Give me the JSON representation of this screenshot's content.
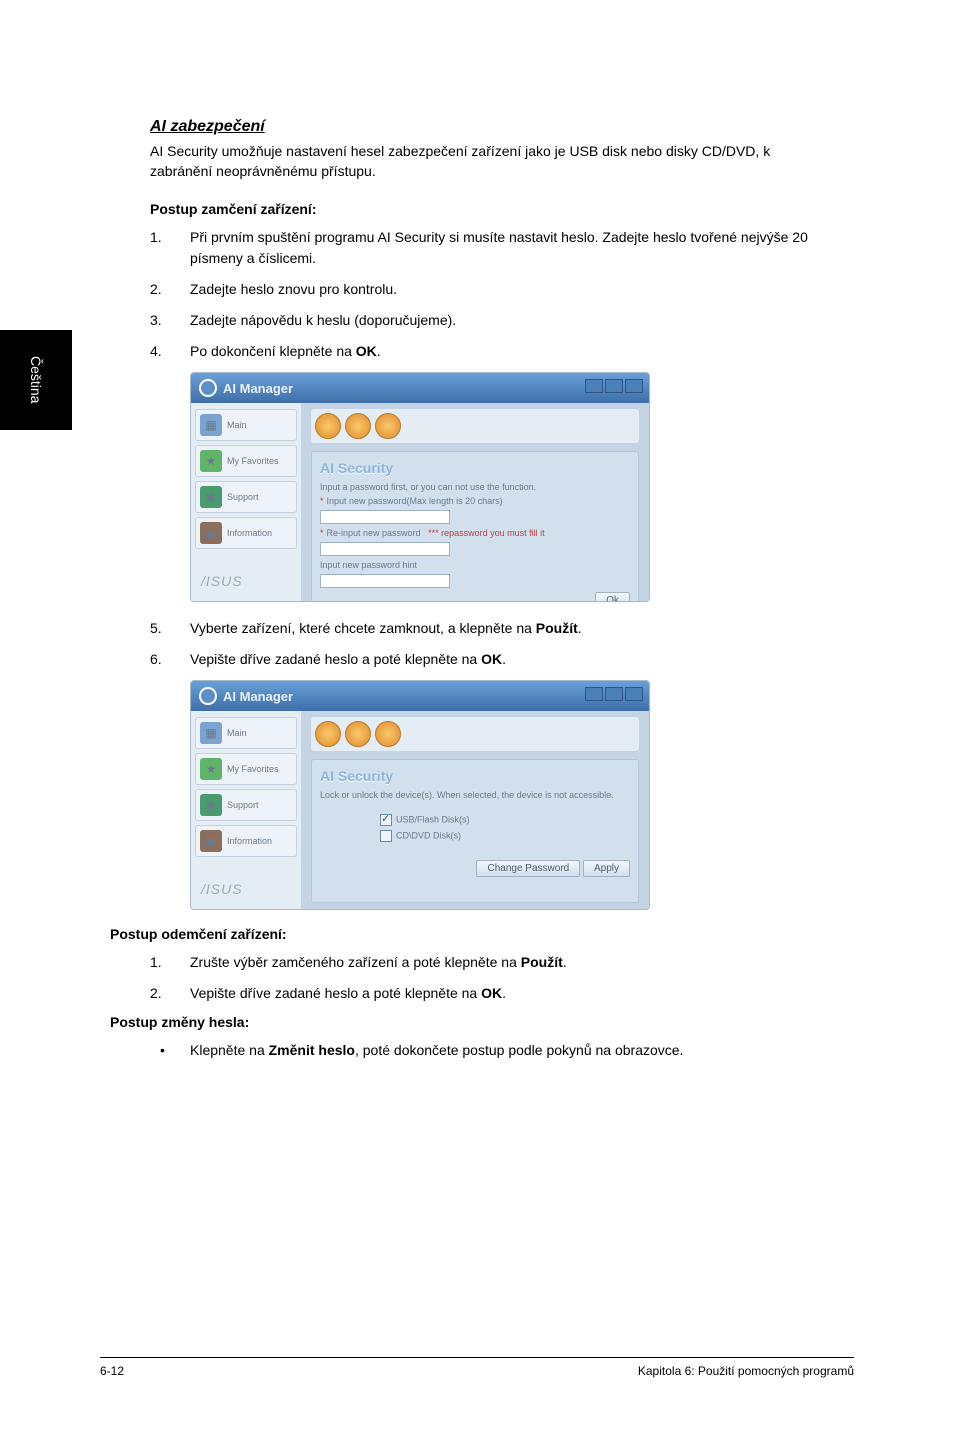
{
  "sideTab": "Čeština",
  "sectionTitle": "AI zabezpečení",
  "intro": "AI Security umožňuje nastavení hesel zabezpečení zařízení jako je USB disk nebo disky CD/DVD, k zabránění neoprávněnému přístupu.",
  "lockHeading": "Postup zamčení zařízení:",
  "steps1": {
    "s1num": "1.",
    "s1": "Při prvním spuštění programu AI Security si musíte nastavit heslo. Zadejte heslo tvořené nejvýše 20 písmeny a číslicemi.",
    "s2num": "2.",
    "s2": "Zadejte heslo znovu pro kontrolu.",
    "s3num": "3.",
    "s3": "Zadejte nápovědu k heslu (doporučujeme).",
    "s4num": "4.",
    "s4a": "Po dokončení klepněte na ",
    "s4b": "OK",
    "s4c": "."
  },
  "steps2": {
    "s5num": "5.",
    "s5a": "Vyberte zařízení, které chcete zamknout, a klepněte na ",
    "s5b": "Použít",
    "s5c": ".",
    "s6num": "6.",
    "s6a": "Vepište dříve zadané heslo a poté klepněte na ",
    "s6b": "OK",
    "s6c": "."
  },
  "unlockHeading": "Postup odemčení zařízení:",
  "unlockSteps": {
    "u1num": "1.",
    "u1a": "Zrušte výběr zamčeného zařízení a poté klepněte na ",
    "u1b": "Použít",
    "u1c": ".",
    "u2num": "2.",
    "u2a": "Vepište dříve zadané heslo a poté klepněte na ",
    "u2b": "OK",
    "u2c": "."
  },
  "changeHeading": "Postup změny hesla:",
  "changeStep": {
    "dot": "•",
    "a": "Klepněte na ",
    "b": "Změnit heslo",
    "c": ", poté dokončete postup podle pokynů na obrazovce."
  },
  "screenshot1": {
    "appTitle": "AI Manager",
    "tabs": {
      "main": "Main",
      "fav": "My Favorites",
      "support": "Support",
      "info": "Information"
    },
    "brand": "/ISUS",
    "panelTitle": "AI Security",
    "line1": "Input a password first, or you can not use the function.",
    "line2": "Input new password(Max length is 20 chars)",
    "line3": "Re-input new password",
    "line3warn": "*** repassword you must fill it",
    "line4": "Input new password hint",
    "okBtn": "Ok"
  },
  "screenshot2": {
    "appTitle": "AI Manager",
    "tabs": {
      "main": "Main",
      "fav": "My Favorites",
      "support": "Support",
      "info": "Information"
    },
    "brand": "/ISUS",
    "panelTitle": "AI Security",
    "line1": "Lock or unlock the device(s). When selected, the device is not accessible.",
    "dev1": "USB/Flash Disk(s)",
    "dev2": "CD\\DVD Disk(s)",
    "changeBtn": "Change Password",
    "applyBtn": "Apply"
  },
  "footer": {
    "left": "6-12",
    "right": "Kapitola 6: Použití pomocných programů"
  }
}
